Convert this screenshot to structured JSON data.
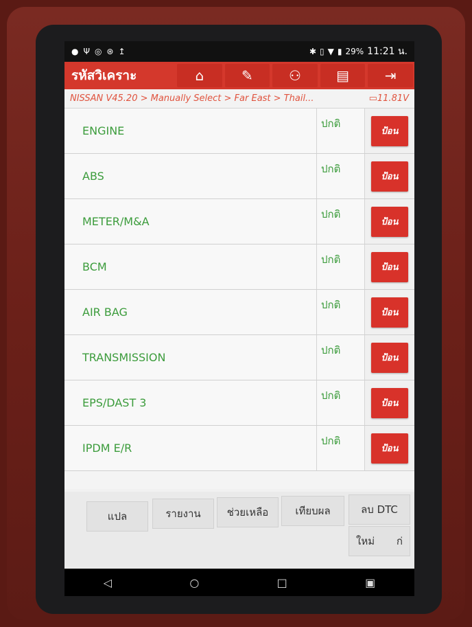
{
  "status_bar": {
    "left_icons": [
      "notification-icon",
      "usb-icon",
      "vpn-icon",
      "settings-icon",
      "upload-icon"
    ],
    "right_icons": [
      "bluetooth-icon",
      "vibrate-icon",
      "wifi-icon",
      "signal-icon"
    ],
    "battery": "29%",
    "time": "11:21 น."
  },
  "header": {
    "title": "รหัสวิเคราะ",
    "buttons": [
      "home-icon",
      "edit-icon",
      "user-icon",
      "print-icon",
      "exit-icon"
    ]
  },
  "breadcrumb": {
    "path": "NISSAN V45.20 > Manually Select > Far East > Thail...",
    "voltage": "11.81V"
  },
  "systems": [
    {
      "name": "ENGINE",
      "status": "ปกติ",
      "action": "ป้อน"
    },
    {
      "name": "ABS",
      "status": "ปกติ",
      "action": "ป้อน"
    },
    {
      "name": "METER/M&A",
      "status": "ปกติ",
      "action": "ป้อน"
    },
    {
      "name": "BCM",
      "status": "ปกติ",
      "action": "ป้อน"
    },
    {
      "name": "AIR BAG",
      "status": "ปกติ",
      "action": "ป้อน"
    },
    {
      "name": "TRANSMISSION",
      "status": "ปกติ",
      "action": "ป้อน"
    },
    {
      "name": "EPS/DAST 3",
      "status": "ปกติ",
      "action": "ป้อน"
    },
    {
      "name": "IPDM E/R",
      "status": "ปกติ",
      "action": "ป้อน"
    }
  ],
  "actions": {
    "translate": "แปล",
    "report": "รายงาน",
    "help": "ช่วยเหลือ",
    "compare": "เทียบผล",
    "clear_dtc": "ลบ DTC",
    "new": "ใหม่",
    "next": "ก่"
  },
  "nav": {
    "back": "◁",
    "home": "○",
    "recent": "□",
    "screenshot": "▣"
  },
  "colors": {
    "accent": "#d4382c",
    "status_green": "#3c9c3c",
    "breadcrumb": "#e0533e"
  }
}
